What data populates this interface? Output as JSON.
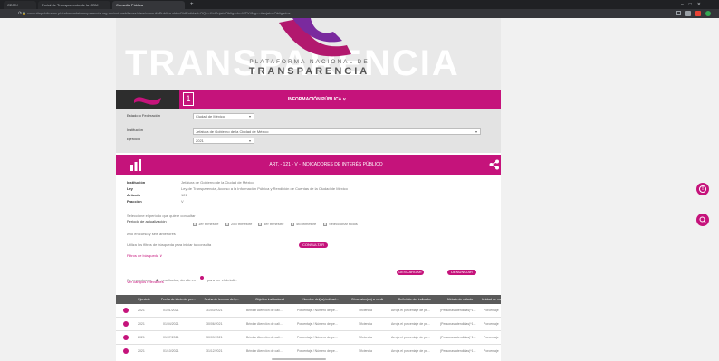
{
  "browser": {
    "tabs": [
      {
        "label": "CDMX"
      },
      {
        "label": "Portal de Transparencia de la CDM"
      },
      {
        "label": "Consulta Pública"
      }
    ],
    "url": "consultapublicamx.plataformadetransparencia.org.mx/vut-web/faces/view/consultaPublica.xhtml?idEntidad=OQ==&idSujetoObligado=MTY4Ng==#sujetosObligados"
  },
  "banner": {
    "watermark": "TRANSPARENCIA",
    "line1": "PLATAFORMA NACIONAL DE",
    "line2": "TRANSPARENCIA"
  },
  "nav": {
    "title": "INFORMACIÓN PÚBLICA ∨"
  },
  "filters": {
    "estado_label": "Estado o Federación",
    "estado_value": "Ciudad de México",
    "institucion_label": "Institución",
    "institucion_value": "Jefatura de Gobierno de la Ciudad de México",
    "ejercicio_label": "Ejercicio",
    "ejercicio_value": "2021"
  },
  "section": {
    "title": "ART. - 121 - V - INDICADORES DE INTERÉS PÚBLICO"
  },
  "details": {
    "institucion_label": "Institución",
    "institucion_value": "Jefatura de Gobierno de la Ciudad de México",
    "ley_label": "Ley",
    "ley_value": "Ley de Transparencia, Acceso a la Información Pública y Rendición de Cuentas de la Ciudad de México",
    "articulo_label": "Artículo",
    "articulo_value": "121",
    "fraccion_label": "Fracción",
    "fraccion_value": "V"
  },
  "periodo": {
    "intro": "Seleccione el periodo que quiere consultar",
    "label": "Periodo de actualización",
    "options": [
      {
        "label": "1er trimestre"
      },
      {
        "label": "2do trimestre"
      },
      {
        "label": "3er trimestre"
      },
      {
        "label": "4to trimestre"
      },
      {
        "label": "Seleccionar todos"
      }
    ]
  },
  "anio_text": "Año en curso y seis anteriores",
  "search": {
    "hint": "Utiliza los filtros de búsqueda para iniciar tu consulta",
    "consultar": "CONSULTAR",
    "filtros_link": "Filtros de búsqueda ∨"
  },
  "results": {
    "found_pre": "Se encontraron",
    "count": "4",
    "found_mid": "resultados, da clic en",
    "found_post": "para ver el detalle.",
    "descargar": "DESCARGAR",
    "denunciar": "DENUNCIAR",
    "ver_campos": "Ver campos relevantes"
  },
  "table": {
    "headers": [
      "Ejercicio",
      "Fecha de inicio del per...",
      "Fecha de termino del p...",
      "Objetivo institucional",
      "Nombre del(os) indicad...",
      "Dimension(es) a medir",
      "Definición del indicador",
      "Método de cálculo",
      "Unidad de me"
    ],
    "rows": [
      [
        "2021",
        "01/01/2021",
        "31/03/2021",
        "Brindar Atención de cali...",
        "Porcentaje / Número de pe...",
        "Eficiencia",
        "Arroja el porcentaje de pe...",
        "(Personas atendidas)*1...",
        "Porcentaje"
      ],
      [
        "2021",
        "01/04/2021",
        "30/06/2021",
        "Brindar Atención de cali...",
        "Porcentaje / Número de pe...",
        "Eficiencia",
        "Arroja el porcentaje de pe...",
        "(Personas atendidas)*1...",
        "Porcentaje"
      ],
      [
        "2021",
        "01/07/2021",
        "30/09/2021",
        "Brindar Atención de cali...",
        "Porcentaje / Número de pe...",
        "Eficiencia",
        "Arroja el porcentaje de pe...",
        "(Personas atendidas)*1...",
        "Porcentaje"
      ],
      [
        "2021",
        "01/10/2021",
        "31/12/2021",
        "Brindar Atención de cali...",
        "Porcentaje / Número de pe...",
        "Eficiencia",
        "Arroja el porcentaje de pe...",
        "(Personas atendidas)*1...",
        "Porcentaje"
      ]
    ]
  },
  "colors": {
    "accent": "#c5137b",
    "dark": "#2d2d2d",
    "header": "#5a5a5a"
  }
}
